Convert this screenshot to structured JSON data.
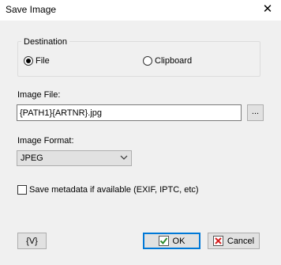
{
  "window": {
    "title": "Save Image",
    "close_glyph": "✕"
  },
  "destination": {
    "group_label": "Destination",
    "options": [
      {
        "label": "File",
        "selected": true
      },
      {
        "label": "Clipboard",
        "selected": false
      }
    ]
  },
  "image_file": {
    "label": "Image File:",
    "value": "{PATH1}{ARTNR}.jpg",
    "browse_label": "..."
  },
  "image_format": {
    "label": "Image Format:",
    "selected": "JPEG"
  },
  "metadata": {
    "label": "Save metadata if available (EXIF, IPTC, etc)",
    "checked": false
  },
  "buttons": {
    "variables_label": "{V}",
    "ok_label": "OK",
    "cancel_label": "Cancel"
  },
  "icons": {
    "ok": "check-icon",
    "cancel": "x-icon",
    "colors": {
      "ok_check": "#2e8b2e",
      "cancel_x": "#d62020",
      "default_border": "#0078d7"
    }
  }
}
